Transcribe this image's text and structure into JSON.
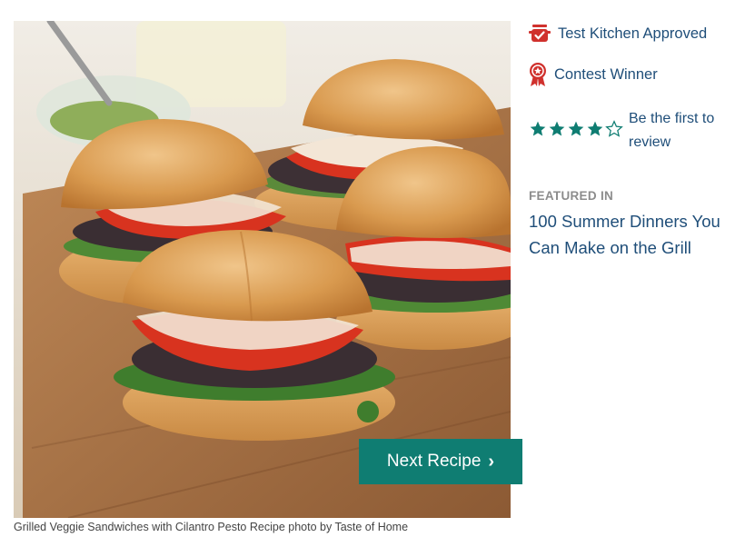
{
  "recipe": {
    "caption": "Grilled Veggie Sandwiches with Cilantro Pesto Recipe photo by Taste of Home",
    "next_label": "Next Recipe"
  },
  "badges": {
    "test_kitchen": "Test Kitchen Approved",
    "contest": "Contest Winner"
  },
  "rating": {
    "filled_stars": 4,
    "total_stars": 5,
    "review_text": "Be the first to review"
  },
  "featured": {
    "label": "FEATURED IN",
    "title": "100 Summer Dinners You Can Make on the Grill"
  },
  "colors": {
    "accent": "#0f7d72",
    "link": "#1f4e79",
    "badge_red": "#d0312d",
    "muted": "#8c8c8c"
  }
}
